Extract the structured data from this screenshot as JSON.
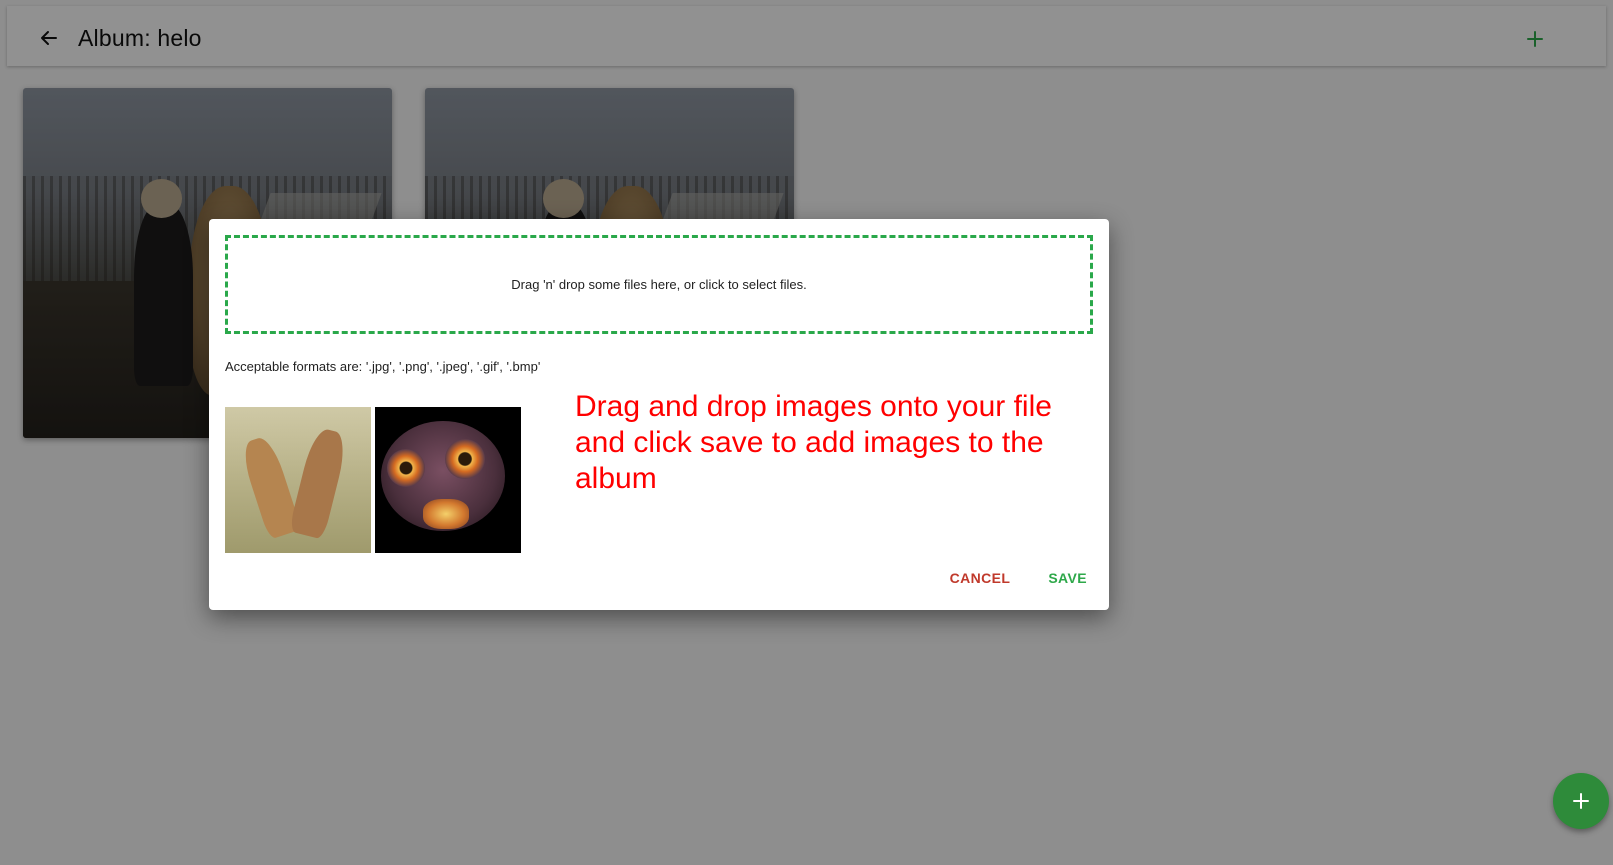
{
  "header": {
    "title": "Album: helo"
  },
  "gallery": {
    "cards": [
      {
        "kind": "photo",
        "subject": "child-and-dog"
      },
      {
        "kind": "photo",
        "subject": "child-and-dog"
      }
    ]
  },
  "dialog": {
    "dropzone_text": "Drag 'n' drop some files here, or click to select files.",
    "formats_text": "Acceptable formats are: '.jpg', '.png', '.jpeg', '.gif', '.bmp'",
    "annotation": "Drag and drop images onto your file and click save to add images to the album",
    "cancel_label": "CANCEL",
    "save_label": "SAVE"
  },
  "icons": {
    "back": "arrow-back-icon",
    "add_top": "plus-icon",
    "fab": "plus-icon"
  },
  "colors": {
    "accent_green": "#2ea84a",
    "cancel_red": "#c0392b",
    "annotation_red": "#ff0000",
    "fab_green": "#2e8b3a"
  }
}
